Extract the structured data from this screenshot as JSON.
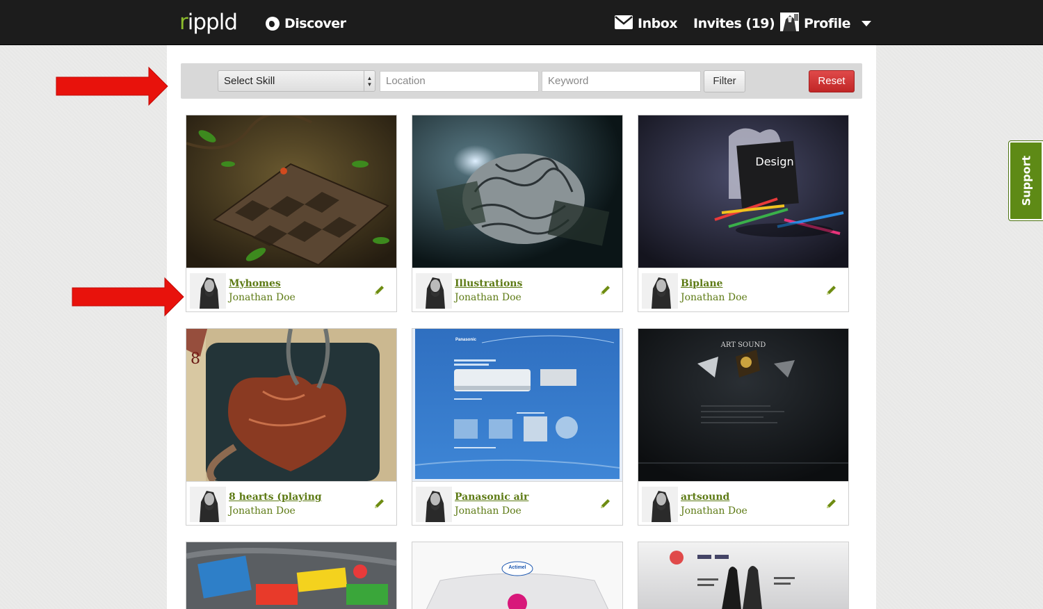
{
  "header": {
    "logo": {
      "accent": "r",
      "rest": "ippld"
    },
    "nav": {
      "discover": "Discover",
      "inbox": "Inbox",
      "invites": "Invites (19)",
      "profile": "Profile"
    }
  },
  "filters": {
    "skill_select": "Select Skill",
    "location_placeholder": "Location",
    "keyword_placeholder": "Keyword",
    "filter_label": "Filter",
    "reset_label": "Reset"
  },
  "support_label": "Support",
  "projects": [
    {
      "title": "Myhomes",
      "author": "Jonathan Doe"
    },
    {
      "title": "Illustrations",
      "author": "Jonathan Doe"
    },
    {
      "title": "Biplane",
      "author": "Jonathan Doe",
      "thumb_text": "Design"
    },
    {
      "title": "8 hearts (playing",
      "author": "Jonathan Doe"
    },
    {
      "title": "Panasonic air",
      "author": "Jonathan Doe",
      "thumb_text": "Panasonic"
    },
    {
      "title": "artsound",
      "author": "Jonathan Doe",
      "thumb_text": "ART SOUND"
    },
    {
      "title": "",
      "author": ""
    },
    {
      "title": "",
      "author": "",
      "thumb_text": "Actimel"
    },
    {
      "title": "",
      "author": ""
    }
  ],
  "colors": {
    "brand_green": "#8cbc2c",
    "link_green": "#5d7a14",
    "support_green": "#5e8a16",
    "reset_red": "#c9302c",
    "annotation_red": "#e8120c",
    "nav_bg": "#1c1c1c"
  }
}
